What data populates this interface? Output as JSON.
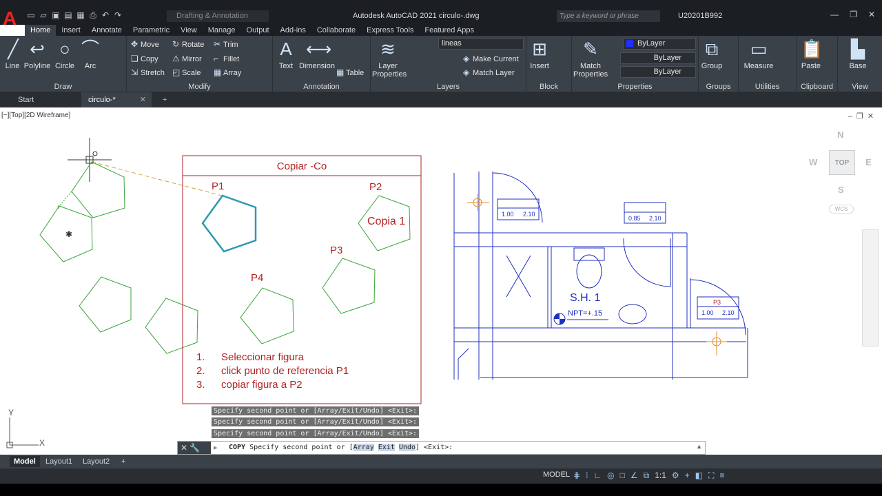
{
  "app": {
    "title": "Autodesk AutoCAD 2021    circulo-.dwg",
    "workspace": "Drafting & Annotation",
    "search_placeholder": "Type a keyword or phrase",
    "user": "U20201B992"
  },
  "ribbon_tabs": [
    "Home",
    "Insert",
    "Annotate",
    "Parametric",
    "View",
    "Manage",
    "Output",
    "Add-ins",
    "Collaborate",
    "Express Tools",
    "Featured Apps"
  ],
  "ribbon": {
    "draw": {
      "title": "Draw",
      "line": "Line",
      "polyline": "Polyline",
      "circle": "Circle",
      "arc": "Arc"
    },
    "modify": {
      "title": "Modify",
      "move": "Move",
      "rotate": "Rotate",
      "trim": "Trim",
      "copy": "Copy",
      "mirror": "Mirror",
      "fillet": "Fillet",
      "stretch": "Stretch",
      "scale": "Scale",
      "array": "Array"
    },
    "annotation": {
      "title": "Annotation",
      "text": "Text",
      "dimension": "Dimension",
      "table": "Table"
    },
    "layers": {
      "title": "Layers",
      "layer_properties": "Layer Properties",
      "current_layer": "lineas",
      "make_current": "Make Current",
      "match_layer": "Match Layer"
    },
    "block": {
      "title": "Block",
      "insert": "Insert"
    },
    "properties": {
      "title": "Properties",
      "match_properties": "Match Properties",
      "color": "ByLayer",
      "linetype": "ByLayer",
      "lineweight": "ByLayer"
    },
    "groups": {
      "title": "Groups",
      "group": "Group"
    },
    "utilities": {
      "title": "Utilities",
      "measure": "Measure"
    },
    "clipboard": {
      "title": "Clipboard",
      "paste": "Paste"
    },
    "view": {
      "title": "View",
      "base": "Base"
    }
  },
  "doc_tabs": {
    "start": "Start",
    "file": "circulo-*"
  },
  "viewport_label": "[−][Top][2D Wireframe]",
  "drawing": {
    "box_title": "Copiar -Co",
    "p1": "P1",
    "p2": "P2",
    "p3": "P3",
    "p4": "P4",
    "copia": "Copia 1",
    "steps": [
      {
        "num": "1.",
        "text": "Seleccionar figura"
      },
      {
        "num": "2.",
        "text": "click punto de referencia P1"
      },
      {
        "num": "3.",
        "text": "copiar figura a P2"
      }
    ],
    "plan": {
      "sh": "S.H. 1",
      "npt": "NPT=+.15",
      "w1a": "1.00",
      "w1b": "2.10",
      "w2a": "0.85",
      "w2b": "2.10",
      "p3": "P3",
      "w3a": "1.00",
      "w3b": "2.10"
    },
    "ucs_x": "X",
    "ucs_y": "Y"
  },
  "viewcube": {
    "top": "TOP",
    "n": "N",
    "s": "S",
    "e": "E",
    "w": "W",
    "wcs": "WCS"
  },
  "command": {
    "history": [
      "Specify second point or [Array/Exit/Undo] <Exit>:",
      "Specify second point or [Array/Exit/Undo] <Exit>:",
      "Specify second point or [Array/Exit/Undo] <Exit>:"
    ],
    "name": "COPY",
    "prompt_pre": "Specify second point or [",
    "opt1": "Array",
    "opt2": "Exit",
    "opt3": "Undo",
    "prompt_post": "] <Exit>:"
  },
  "layout_tabs": [
    "Model",
    "Layout1",
    "Layout2"
  ],
  "status": {
    "model": "MODEL",
    "scale": "1:1"
  },
  "colors": {
    "green": "#2e9e2e",
    "red": "#b22222",
    "blue": "#1f2fbf",
    "teal": "#2a9ab0",
    "ribbon": "#3b4149"
  }
}
